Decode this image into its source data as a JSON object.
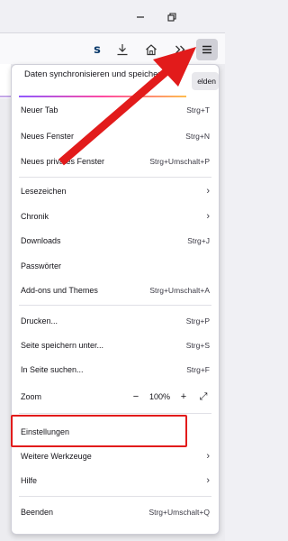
{
  "menu": {
    "sync_text": "Daten synchronisieren und speichern",
    "sync_button": "elden",
    "items": [
      {
        "label": "Neuer Tab",
        "shortcut": "Strg+T"
      },
      {
        "label": "Neues Fenster",
        "shortcut": "Strg+N"
      },
      {
        "label": "Neues privates Fenster",
        "shortcut": "Strg+Umschalt+P"
      },
      {
        "label": "Lesezeichen",
        "shortcut": ""
      },
      {
        "label": "Chronik",
        "shortcut": ""
      },
      {
        "label": "Downloads",
        "shortcut": "Strg+J"
      },
      {
        "label": "Passwörter",
        "shortcut": ""
      },
      {
        "label": "Add-ons und Themes",
        "shortcut": "Strg+Umschalt+A"
      },
      {
        "label": "Drucken...",
        "shortcut": "Strg+P"
      },
      {
        "label": "Seite speichern unter...",
        "shortcut": "Strg+S"
      },
      {
        "label": "In Seite suchen...",
        "shortcut": "Strg+F"
      },
      {
        "label": "Zoom",
        "shortcut": ""
      },
      {
        "label": "Einstellungen",
        "shortcut": ""
      },
      {
        "label": "Weitere Werkzeuge",
        "shortcut": ""
      },
      {
        "label": "Hilfe",
        "shortcut": ""
      },
      {
        "label": "Beenden",
        "shortcut": "Strg+Umschalt+Q"
      }
    ],
    "zoom": {
      "minus": "−",
      "value": "100%",
      "plus": "+",
      "fullscreen": "⤢"
    }
  },
  "icons": {
    "minimize": "minimize-icon",
    "restore": "restore-icon",
    "sync": "sync-icon",
    "download": "download-icon",
    "home": "home-icon",
    "overflow": "chevron-double-right-icon",
    "hamburger": "hamburger-menu-icon"
  },
  "colors": {
    "annotation": "#e21b1b",
    "sync_brand": "#0b3a6b"
  }
}
